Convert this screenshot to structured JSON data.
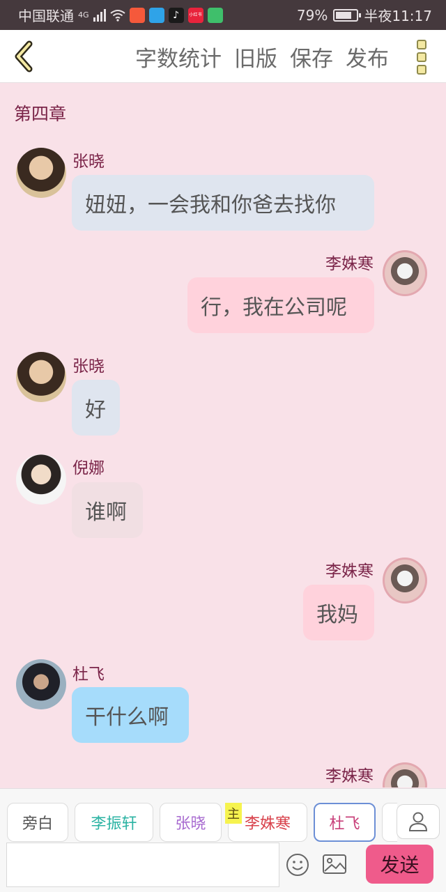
{
  "status_bar": {
    "carrier": "中国联通",
    "network": "4G",
    "battery": "79%",
    "battery_level": 0.79,
    "time": "半夜11:17",
    "app_icons": [
      "kuaishou-icon",
      "qq-browser-icon",
      "tiktok-icon",
      "xiaohongshu-icon",
      "tencent-video-icon"
    ],
    "app_icon_colors": [
      "#f5593b",
      "#2fa3e8",
      "#1a1a1a",
      "#e8233c",
      "#3fbf6b"
    ],
    "xiaohongshu_label": "小红书"
  },
  "toolbar": {
    "back_icon": "chevron-left-icon",
    "word_count": "字数统计",
    "old_version": "旧版",
    "save": "保存",
    "publish": "发布",
    "more_icon": "more-vertical-icon"
  },
  "chat": {
    "chapter_title": "第四章",
    "messages": [
      {
        "sender": "张晓",
        "text": "妞妞，一会我和你爸去找你",
        "side": "left",
        "bubble_color": "#dfe5ef"
      },
      {
        "sender": "李姝寒",
        "text": "行，我在公司呢",
        "side": "right",
        "bubble_color": "#ffd2dc"
      },
      {
        "sender": "张晓",
        "text": "好",
        "side": "left",
        "bubble_color": "#dfe5ef"
      },
      {
        "sender": "倪娜",
        "text": "谁啊",
        "side": "left",
        "bubble_color": "#f1dfe3"
      },
      {
        "sender": "李姝寒",
        "text": "我妈",
        "side": "right",
        "bubble_color": "#ffd2dc"
      },
      {
        "sender": "杜飞",
        "text": "干什么啊",
        "side": "left",
        "bubble_color": "#a6dcfb"
      },
      {
        "sender": "李姝寒",
        "text": "",
        "side": "right",
        "bubble_color": "#ffd2dc"
      }
    ]
  },
  "characters": {
    "chips": [
      {
        "label": "旁白",
        "color": "#555555"
      },
      {
        "label": "李振轩",
        "color": "#2bb3a3"
      },
      {
        "label": "张晓",
        "color": "#a86bd0"
      },
      {
        "label": "李姝寒",
        "color": "#d8404a"
      },
      {
        "label": "杜飞",
        "color": "#c8407a"
      }
    ],
    "main_badge": "主",
    "user_icon": "person-icon"
  },
  "composer": {
    "placeholder": "",
    "emoji_icon": "smiley-icon",
    "image_icon": "image-icon",
    "send": "发送"
  }
}
